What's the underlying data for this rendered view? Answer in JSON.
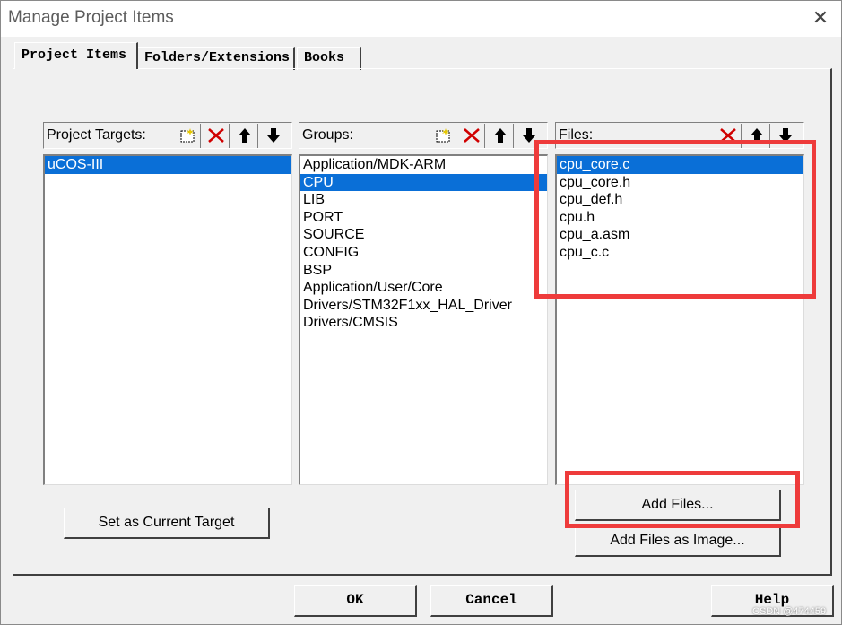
{
  "window": {
    "title": "Manage Project Items"
  },
  "tabs": [
    "Project Items",
    "Folders/Extensions",
    "Books"
  ],
  "targets": {
    "label": "Project Targets:",
    "items": [
      "uCOS-III"
    ],
    "selected_index": 0
  },
  "groups": {
    "label": "Groups:",
    "items": [
      "Application/MDK-ARM",
      "CPU",
      "LIB",
      "PORT",
      "SOURCE",
      "CONFIG",
      "BSP",
      "Application/User/Core",
      "Drivers/STM32F1xx_HAL_Driver",
      "Drivers/CMSIS"
    ],
    "selected_index": 1
  },
  "files": {
    "label": "Files:",
    "items": [
      "cpu_core.c",
      "cpu_core.h",
      "cpu_def.h",
      "cpu.h",
      "cpu_a.asm",
      "cpu_c.c"
    ],
    "selected_index": 0
  },
  "buttons": {
    "set_target": "Set as Current Target",
    "add_files": "Add Files...",
    "add_files_image": "Add Files as Image...",
    "ok": "OK",
    "cancel": "Cancel",
    "help": "Help"
  },
  "watermark": "CSDN @474459",
  "colors": {
    "selection": "#0a6fd7",
    "annotation": "#ee3b3b"
  },
  "icons": [
    "new-item-icon",
    "delete-icon",
    "move-up-icon",
    "move-down-icon",
    "close-icon"
  ]
}
